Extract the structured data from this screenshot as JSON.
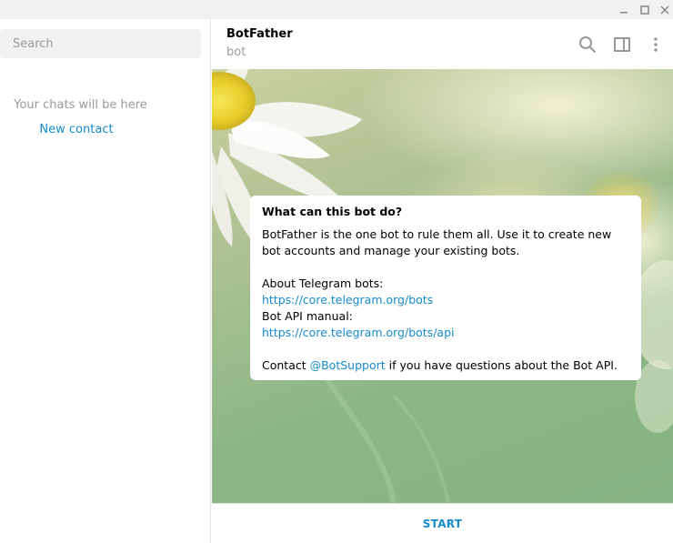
{
  "window": {
    "controls": [
      "minimize",
      "maximize",
      "close"
    ]
  },
  "sidebar": {
    "search_placeholder": "Search",
    "empty_text": "Your chats will be here",
    "new_contact": "New contact"
  },
  "chat": {
    "title": "BotFather",
    "status": "bot",
    "header_icons": [
      "search-icon",
      "side-panel-icon",
      "more-vertical-icon"
    ]
  },
  "bot_info": {
    "heading": "What can this bot do?",
    "description": "BotFather is the one bot to rule them all. Use it to create new bot accounts and manage your existing bots.",
    "about_label": "About Telegram bots:",
    "about_link": "https://core.telegram.org/bots",
    "api_label": "Bot API manual:",
    "api_link": "https://core.telegram.org/bots/api",
    "contact_prefix": "Contact ",
    "contact_handle": "@BotSupport",
    "contact_suffix": " if you have questions about the Bot API."
  },
  "footer": {
    "start_label": "START"
  },
  "colors": {
    "accent": "#168acd",
    "muted": "#999999",
    "search_bg": "#f1f1f1"
  }
}
